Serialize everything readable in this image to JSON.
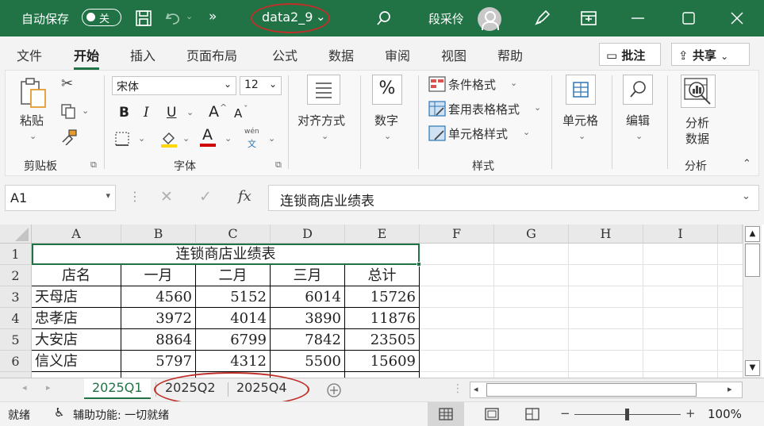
{
  "titlebar": {
    "autosave_label": "自动保存",
    "autosave_state": "关",
    "filename": "data2_9",
    "user_name": "段采伶",
    "overflow_glyph": "»"
  },
  "menu": {
    "tabs": [
      "文件",
      "开始",
      "插入",
      "页面布局",
      "公式",
      "数据",
      "审阅",
      "视图",
      "帮助"
    ],
    "active_tab": "开始",
    "comment_button": "批注",
    "share_button": "共享"
  },
  "ribbon": {
    "paste_label": "粘贴",
    "clipboard_group": "剪贴板",
    "font_name": "宋体",
    "font_size": "12",
    "bold": "B",
    "italic": "I",
    "underline": "U",
    "grow_font": "A",
    "shrink_font": "A",
    "phonetic_top": "wén",
    "phonetic_bottom": "文",
    "font_group": "字体",
    "align_label": "对齐方式",
    "number_label": "数字",
    "percent_glyph": "%",
    "cond_format": "条件格式",
    "table_format": "套用表格格式",
    "cell_style": "单元格样式",
    "styles_group": "样式",
    "cells_label": "单元格",
    "edit_label": "编辑",
    "analyze_label_1": "分析",
    "analyze_label_2": "数据",
    "analyze_group": "分析"
  },
  "formula_bar": {
    "name_box": "A1",
    "fx": "fx",
    "formula": "连锁商店业绩表"
  },
  "sheet": {
    "columns": [
      "A",
      "B",
      "C",
      "D",
      "E",
      "F",
      "G",
      "H",
      "I"
    ],
    "rows": [
      "1",
      "2",
      "3",
      "4",
      "5",
      "6"
    ],
    "title": "连锁商店业绩表",
    "header": [
      "店名",
      "一月",
      "二月",
      "三月",
      "总计"
    ],
    "data": [
      [
        "天母店",
        "4560",
        "5152",
        "6014",
        "15726"
      ],
      [
        "忠孝店",
        "3972",
        "4014",
        "3890",
        "11876"
      ],
      [
        "大安店",
        "8864",
        "6799",
        "7842",
        "23505"
      ],
      [
        "信义店",
        "5797",
        "4312",
        "5500",
        "15609"
      ]
    ]
  },
  "sheet_tabs": [
    "2025Q1",
    "2025Q2",
    "2025Q4"
  ],
  "active_sheet": "2025Q1",
  "status": {
    "ready": "就绪",
    "accessibility": "辅助功能: 一切就绪",
    "zoom": "100%",
    "zoom_minus": "−",
    "zoom_plus": "+"
  }
}
